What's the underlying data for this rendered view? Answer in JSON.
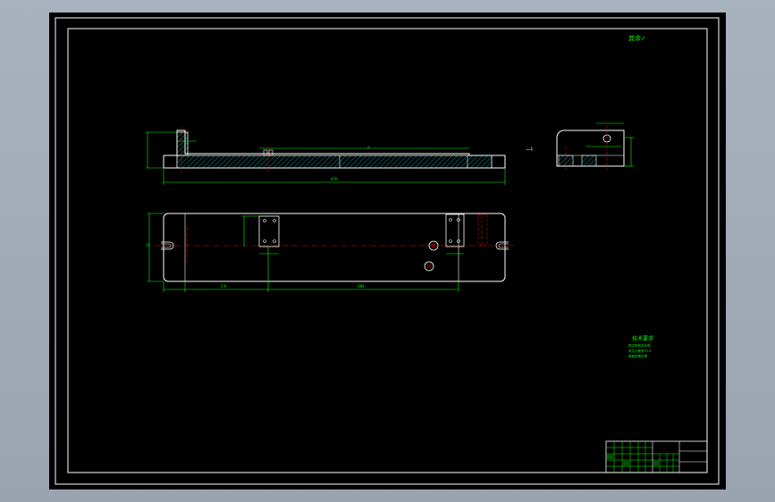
{
  "drawing": {
    "roughness_note": "其余✓",
    "front_view": {
      "overall_length_dim": "476",
      "inner_length_dim": "384",
      "roughness_symbol": "✓"
    },
    "section_marker": "—Ⅰ",
    "plan_view": {
      "dim_a": "5.6",
      "dim_b": "384",
      "dim_c": "15"
    },
    "technical_requirements": {
      "heading": "技术要求",
      "lines": [
        "锐边倒钝去毛刺",
        "未注公差按IT14",
        "表面发黑处理"
      ]
    },
    "title_block": {
      "cells": [
        "",
        "",
        "",
        "",
        "",
        "",
        "",
        "",
        "",
        "",
        "",
        ""
      ]
    }
  },
  "colors": {
    "frame": "#ffffff",
    "geometry": "#ffffff",
    "dimension": "#00ff00",
    "centerline": "#ff0000",
    "hatch": "#00ffff"
  }
}
